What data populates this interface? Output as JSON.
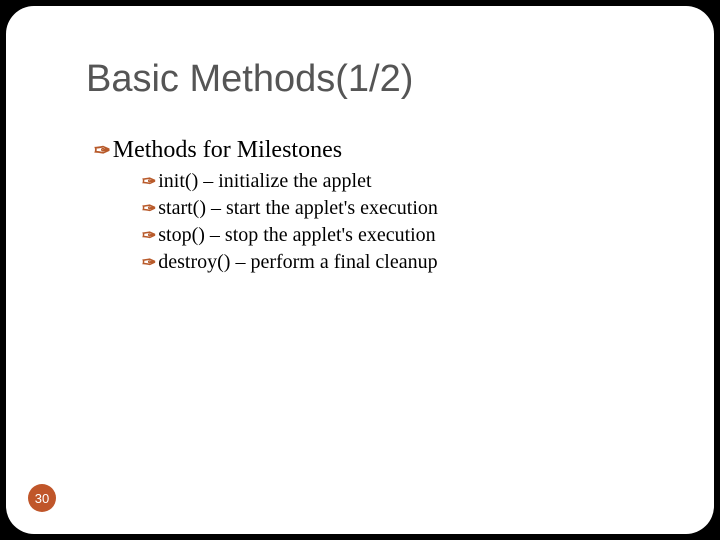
{
  "title": "Basic Methods(1/2)",
  "bullet_glyph": "✑",
  "heading": "Methods for Milestones",
  "items": [
    "init() – initialize the applet",
    "start() – start the applet's execution",
    "stop() – stop the applet's execution",
    "destroy() – perform a final cleanup"
  ],
  "page_number": "30"
}
